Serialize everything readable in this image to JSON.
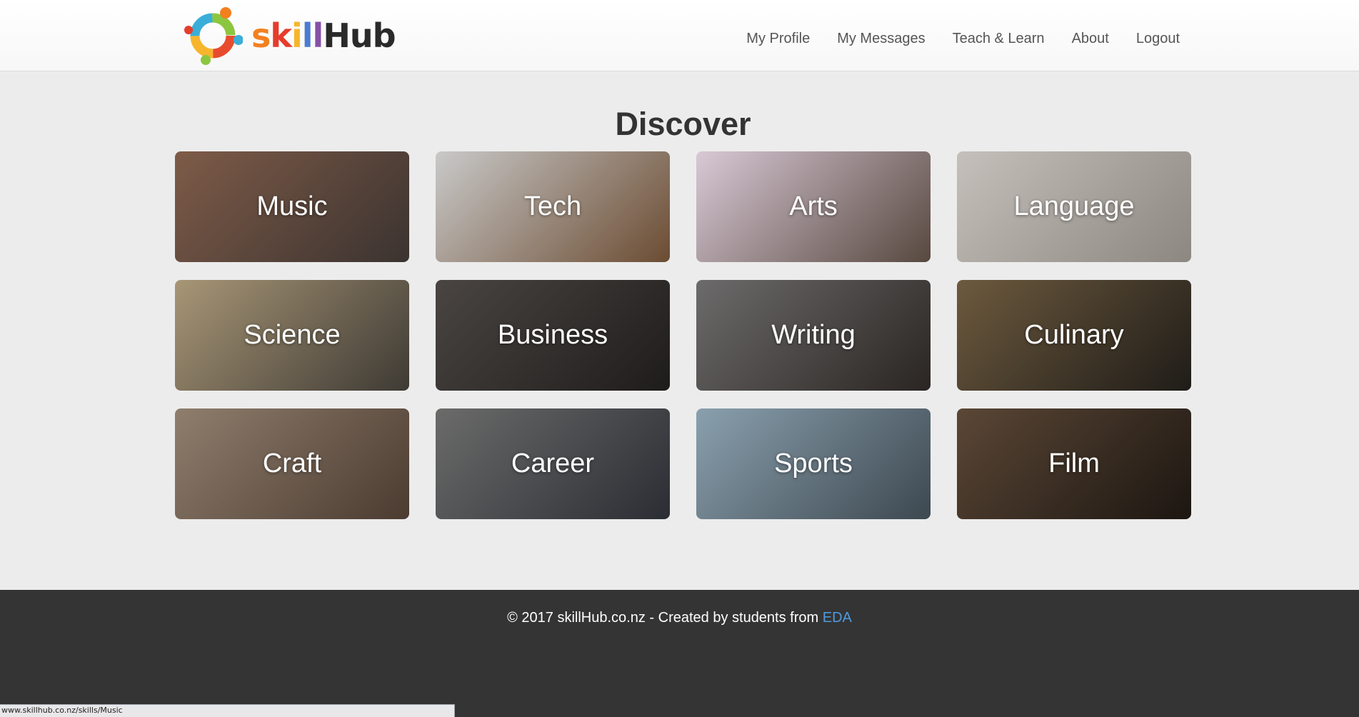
{
  "header": {
    "logo_text_parts": [
      "s",
      "k",
      "i",
      "l",
      "l"
    ],
    "logo_text_rest": "Hub",
    "nav": [
      {
        "label": "My Profile"
      },
      {
        "label": "My Messages"
      },
      {
        "label": "Teach & Learn"
      },
      {
        "label": "About"
      },
      {
        "label": "Logout"
      }
    ]
  },
  "main": {
    "title": "Discover",
    "categories": [
      {
        "label": "Music",
        "colors": [
          "#7e5b48",
          "#3b3330"
        ]
      },
      {
        "label": "Tech",
        "colors": [
          "#c9c9c9",
          "#6b4c32"
        ]
      },
      {
        "label": "Arts",
        "colors": [
          "#d8c9d6",
          "#57483f"
        ]
      },
      {
        "label": "Language",
        "colors": [
          "#c5c0bb",
          "#8d8781"
        ]
      },
      {
        "label": "Science",
        "colors": [
          "#a89676",
          "#3e3a34"
        ]
      },
      {
        "label": "Business",
        "colors": [
          "#4a4542",
          "#1e1c1b"
        ]
      },
      {
        "label": "Writing",
        "colors": [
          "#6c6b6b",
          "#2a2522"
        ]
      },
      {
        "label": "Culinary",
        "colors": [
          "#6d5a3e",
          "#1f1c18"
        ]
      },
      {
        "label": "Craft",
        "colors": [
          "#8f7e6d",
          "#4b3b30"
        ]
      },
      {
        "label": "Career",
        "colors": [
          "#6b6b6a",
          "#2a2d33"
        ]
      },
      {
        "label": "Sports",
        "colors": [
          "#8aa0ae",
          "#3d4850"
        ]
      },
      {
        "label": "Film",
        "colors": [
          "#5b4736",
          "#1c1611"
        ]
      }
    ]
  },
  "footer": {
    "text": "© 2017 skillHub.co.nz - Created by students from ",
    "link": "EDA"
  },
  "statusbar": {
    "url": "www.skillhub.co.nz/skills/Music"
  },
  "colors": {
    "accent_link": "#4f9ae0",
    "footer_bg": "#343434",
    "page_bg": "#ececec"
  }
}
